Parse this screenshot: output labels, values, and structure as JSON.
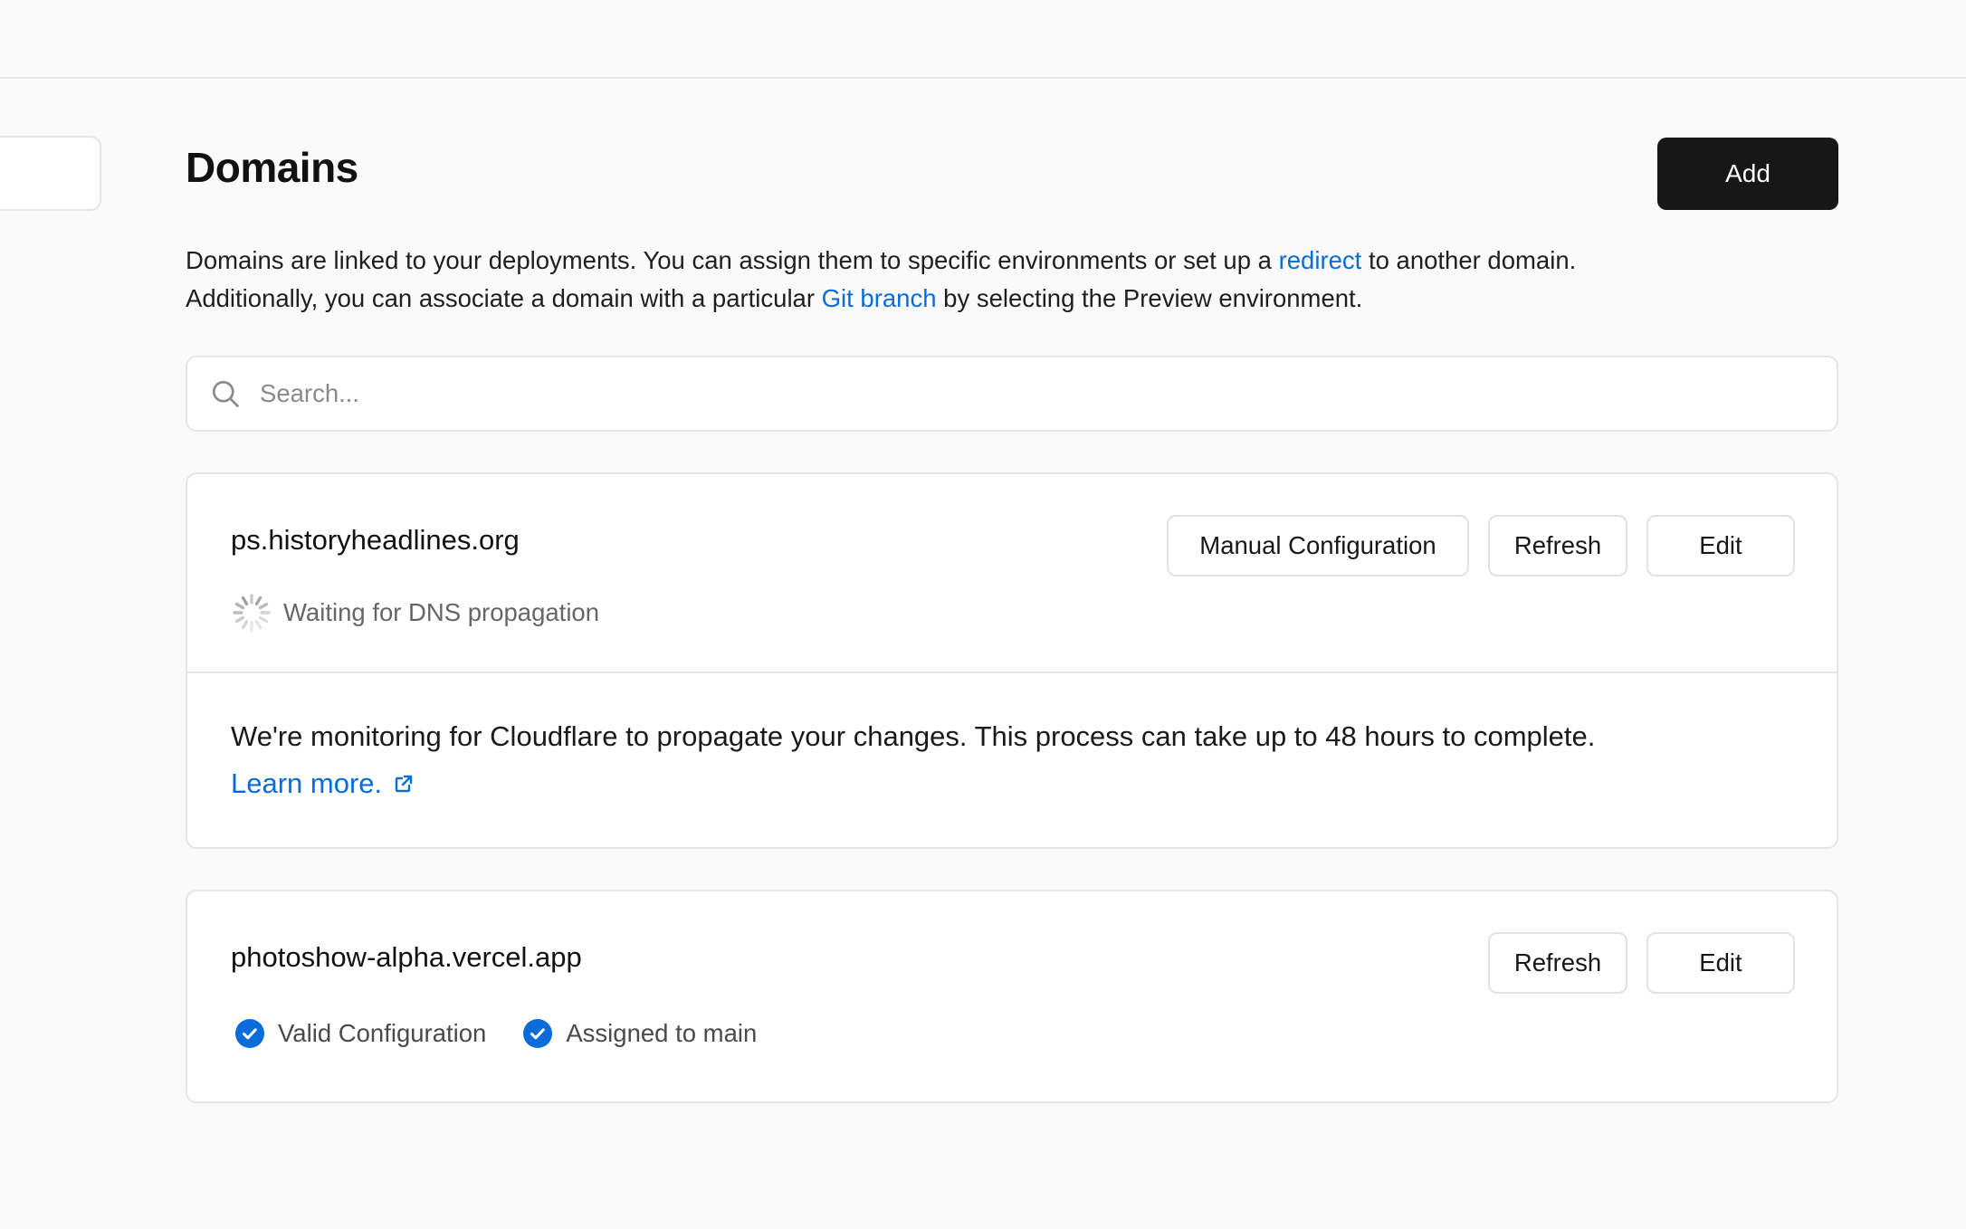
{
  "page": {
    "title": "Domains",
    "add_label": "Add",
    "description": {
      "part1": "Domains are linked to your deployments. You can assign them to specific environments or set up a ",
      "link1": "redirect",
      "part2": " to another domain.",
      "part3": "Additionally, you can associate a domain with a particular ",
      "link2": "Git branch",
      "part4": " by selecting the Preview environment."
    },
    "search": {
      "placeholder": "Search..."
    }
  },
  "domains": [
    {
      "name": "ps.historyheadlines.org",
      "actions": {
        "manual": "Manual Configuration",
        "refresh": "Refresh",
        "edit": "Edit"
      },
      "status": "Waiting for DNS propagation",
      "message": "We're monitoring for Cloudflare to propagate your changes. This process can take up to 48 hours to complete.",
      "learn_more": "Learn more."
    },
    {
      "name": "photoshow-alpha.vercel.app",
      "actions": {
        "refresh": "Refresh",
        "edit": "Edit"
      },
      "badges": [
        "Valid Configuration",
        "Assigned to main"
      ]
    }
  ],
  "colors": {
    "accent": "#0a6cdb",
    "primary_button": "#171717",
    "check": "#0a6cdb"
  },
  "icons": {
    "search": "search-icon",
    "spinner": "spinner-icon",
    "check": "check-circle-icon",
    "external": "external-link-icon"
  }
}
